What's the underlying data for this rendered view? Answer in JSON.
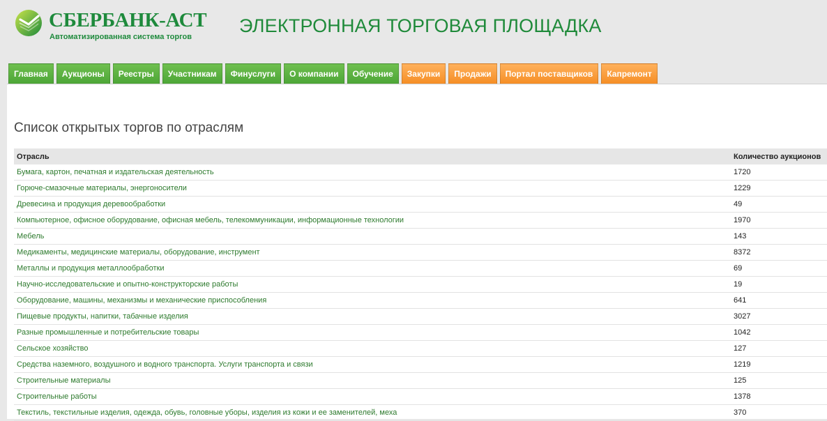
{
  "header": {
    "logo_name": "СБЕРБАНК-АСТ",
    "logo_subtitle": "Автоматизированная система торгов",
    "site_title": "ЭЛЕКТРОННАЯ ТОРГОВАЯ ПЛОЩАДКА"
  },
  "nav": {
    "items": [
      {
        "label": "Главная",
        "color": "green"
      },
      {
        "label": "Аукционы",
        "color": "green"
      },
      {
        "label": "Реестры",
        "color": "green"
      },
      {
        "label": "Участникам",
        "color": "green"
      },
      {
        "label": "Финуслуги",
        "color": "green"
      },
      {
        "label": "О компании",
        "color": "green"
      },
      {
        "label": "Обучение",
        "color": "green"
      },
      {
        "label": "Закупки",
        "color": "orange"
      },
      {
        "label": "Продажи",
        "color": "orange"
      },
      {
        "label": "Портал поставщиков",
        "color": "orange"
      },
      {
        "label": "Капремонт",
        "color": "orange"
      }
    ]
  },
  "main": {
    "title": "Список открытых торгов по отраслям",
    "table": {
      "columns": [
        "Отрасль",
        "Количество аукционов"
      ],
      "rows": [
        {
          "name": "Бумага, картон, печатная и издательская деятельность",
          "count": "1720"
        },
        {
          "name": "Горюче-смазочные материалы, энергоносители",
          "count": "1229"
        },
        {
          "name": "Древесина и продукция деревообработки",
          "count": "49"
        },
        {
          "name": "Компьютерное, офисное оборудование, офисная мебель, телекоммуникации, информационные технологии",
          "count": "1970"
        },
        {
          "name": "Мебель",
          "count": "143"
        },
        {
          "name": "Медикаменты, медицинские материалы, оборудование, инструмент",
          "count": "8372"
        },
        {
          "name": "Металлы и продукция металлообработки",
          "count": "69"
        },
        {
          "name": "Научно-исследовательские и опытно-конструкторские работы",
          "count": "19"
        },
        {
          "name": "Оборудование, машины, механизмы и механические приспособления",
          "count": "641"
        },
        {
          "name": "Пищевые продукты, напитки, табачные изделия",
          "count": "3027"
        },
        {
          "name": "Разные промышленные и потребительские товары",
          "count": "1042"
        },
        {
          "name": "Сельское хозяйство",
          "count": "127"
        },
        {
          "name": "Средства наземного, воздушного и водного транспорта. Услуги транспорта и связи",
          "count": "1219"
        },
        {
          "name": "Строительные материалы",
          "count": "125"
        },
        {
          "name": "Строительные работы",
          "count": "1378"
        },
        {
          "name": "Текстиль, текстильные изделия, одежда, обувь, головные уборы, изделия из кожи и ее заменителей, меха",
          "count": "370"
        }
      ]
    }
  },
  "colors": {
    "brand_green": "#1e8a3c",
    "link_green": "#2d7a2d",
    "tab_green": "#5aad3f",
    "tab_orange": "#f7982f"
  }
}
